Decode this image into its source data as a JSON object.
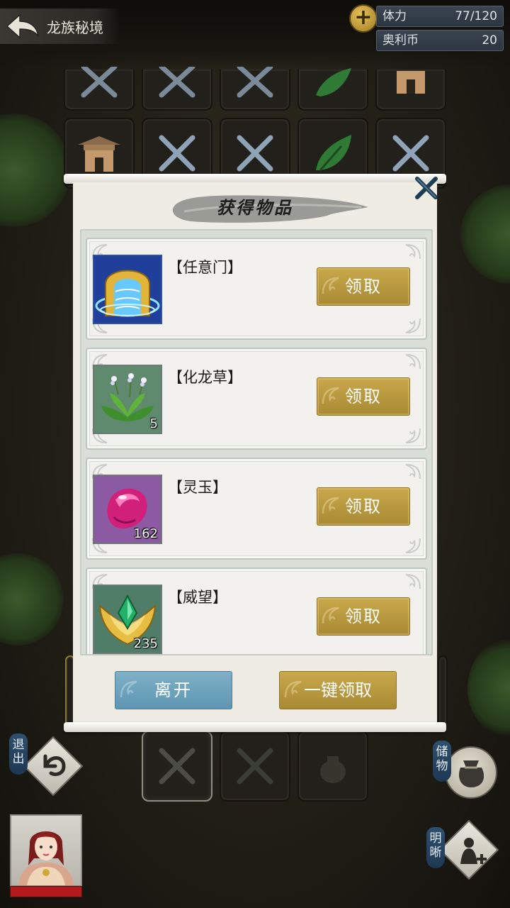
{
  "header": {
    "title": "龙族秘境",
    "stats": [
      {
        "label": "体力",
        "value": "77/120"
      },
      {
        "label": "奥利币",
        "value": "20"
      }
    ]
  },
  "dialog": {
    "title": "获得物品",
    "items": [
      {
        "name": "【任意门】",
        "icon": "gate-icon",
        "qty": "",
        "button": "领取"
      },
      {
        "name": "【化龙草】",
        "icon": "herb-icon",
        "qty": "5",
        "button": "领取"
      },
      {
        "name": "【灵玉】",
        "icon": "jade-icon",
        "qty": "162",
        "button": "领取"
      },
      {
        "name": "【威望】",
        "icon": "prestige-icon",
        "qty": "235",
        "button": "领取"
      }
    ],
    "leave_label": "离开",
    "claim_all_label": "一键领取"
  },
  "hud": {
    "exit_label": "退出",
    "storage_label": "储物",
    "clarity_label": "明晰"
  },
  "colors": {
    "gold_button": "#b89a40",
    "blue_button": "#6fa3bc",
    "hp_bar": "#b31b1b"
  }
}
